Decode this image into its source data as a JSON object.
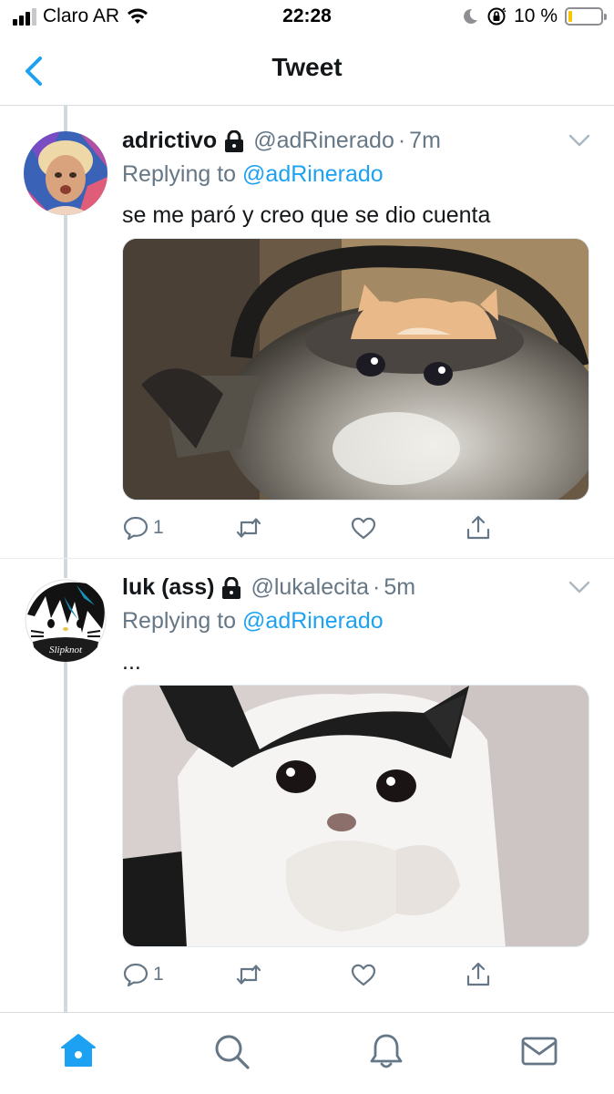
{
  "status_bar": {
    "carrier": "Claro AR",
    "time": "22:28",
    "battery_percent": "10 %",
    "battery_level": 0.1,
    "battery_color": "#f7c600",
    "icons": [
      "signal-icon",
      "wifi-icon",
      "moon-icon",
      "orientation-lock-icon",
      "battery-icon"
    ]
  },
  "header": {
    "title": "Tweet",
    "back_icon": "chevron-left-icon",
    "accent_color": "#1da1f2"
  },
  "tweets": [
    {
      "name": "adrictivo",
      "handle": "@adRinerado",
      "separator": "·",
      "time": "7m",
      "protected": true,
      "replying_prefix": "Replying to",
      "replying_to": "@adRinerado",
      "text": "se me paró y creo que se dio cuenta",
      "media": "photo-cat-in-kettle",
      "replies": "1"
    },
    {
      "name": "luk (ass)",
      "handle": "@lukalecita",
      "separator": "·",
      "time": "5m",
      "protected": true,
      "replying_prefix": "Replying to",
      "replying_to": "@adRinerado",
      "text": "...",
      "media": "photo-crying-cat",
      "avatar_text": "Slipknot",
      "replies": "1"
    }
  ],
  "tab_bar": {
    "items": [
      "home-icon",
      "search-icon",
      "notifications-icon",
      "messages-icon"
    ],
    "active": "home-icon"
  }
}
